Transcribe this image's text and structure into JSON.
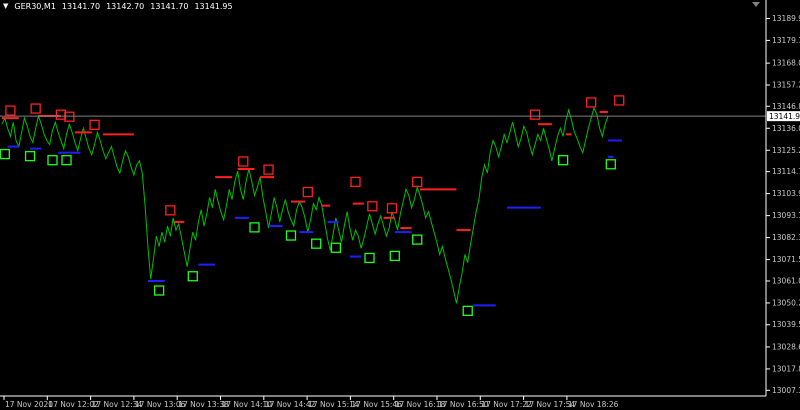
{
  "header": {
    "menu_icon": "triangle-down-icon",
    "symbol": "GER30,M1",
    "ohlc": [
      "13141.70",
      "13142.70",
      "13141.70",
      "13141.95"
    ],
    "scroll_marker_icon": "triangle-down-icon"
  },
  "chart_data": {
    "type": "line",
    "title": "GER30,M1",
    "colors": {
      "background": "#000000",
      "price_line": "#00c000",
      "axis": "#ffffff",
      "axis_text": "#c8c8c8",
      "bid_line": "#808080",
      "resistance": "#ff2020",
      "support": "#2020ff",
      "swing_high_box": "#ff2020",
      "swing_low_box": "#20ff20",
      "current_price_bg": "#ffffff",
      "current_price_text": "#000000"
    },
    "y_axis": {
      "ticks": [
        "13189.90",
        "13179.15",
        "13168.00",
        "13157.25",
        "13146.80",
        "13136.00",
        "13125.20",
        "13114.70",
        "13103.90",
        "13093.10",
        "13082.30",
        "13071.50",
        "13061.00",
        "13050.20",
        "13039.50",
        "13028.60",
        "13017.80",
        "13007.30"
      ],
      "tick_values": [
        13189.9,
        13179.15,
        13168.0,
        13157.25,
        13146.8,
        13136.0,
        13125.2,
        13114.7,
        13103.9,
        13093.1,
        13082.3,
        13071.5,
        13061.0,
        13050.2,
        13039.5,
        13028.6,
        13017.8,
        13007.3
      ],
      "current_price": "13141.95",
      "ylim": [
        13004.5,
        13199.0
      ]
    },
    "x_axis": {
      "ticks": [
        "17 Nov 2020",
        "17 Nov 12:02",
        "17 Nov 12:34",
        "17 Nov 13:06",
        "17 Nov 13:38",
        "17 Nov 14:10",
        "17 Nov 14:42",
        "17 Nov 15:14",
        "17 Nov 15:46",
        "17 Nov 16:18",
        "17 Nov 16:50",
        "17 Nov 17:22",
        "17 Nov 17:54",
        "17 Nov 18:26"
      ]
    },
    "series": [
      {
        "values": [
          13138,
          13141,
          13136,
          13132,
          13139,
          13130,
          13127,
          13134,
          13141,
          13137,
          13132,
          13129,
          13136,
          13142,
          13138,
          13133,
          13130,
          13128,
          13135,
          13139,
          13134,
          13130,
          13126,
          13133,
          13138,
          13134,
          13129,
          13125,
          13131,
          13136,
          13131,
          13126,
          13123,
          13128,
          13134,
          13130,
          13125,
          13121,
          13124,
          13127,
          13122,
          13117,
          13114,
          13120,
          13125,
          13122,
          13117,
          13113,
          13118,
          13120,
          13114,
          13098,
          13078,
          13062,
          13072,
          13083,
          13078,
          13085,
          13080,
          13088,
          13083,
          13092,
          13086,
          13089,
          13082,
          13075,
          13068,
          13077,
          13085,
          13081,
          13090,
          13096,
          13088,
          13094,
          13102,
          13097,
          13106,
          13100,
          13095,
          13091,
          13098,
          13106,
          13101,
          13110,
          13115,
          13106,
          13101,
          13110,
          13116,
          13110,
          13103,
          13107,
          13112,
          13102,
          13095,
          13087,
          13094,
          13102,
          13097,
          13090,
          13096,
          13101,
          13095,
          13091,
          13088,
          13096,
          13100,
          13097,
          13092,
          13085,
          13091,
          13099,
          13096,
          13102,
          13098,
          13090,
          13082,
          13076,
          13084,
          13092,
          13086,
          13080,
          13088,
          13095,
          13087,
          13081,
          13086,
          13083,
          13077,
          13082,
          13088,
          13094,
          13089,
          13084,
          13089,
          13093,
          13088,
          13083,
          13087,
          13095,
          13091,
          13086,
          13094,
          13100,
          13106,
          13103,
          13097,
          13101,
          13107,
          13103,
          13098,
          13092,
          13095,
          13090,
          13085,
          13080,
          13074,
          13078,
          13072,
          13067,
          13062,
          13056,
          13050,
          13058,
          13065,
          13074,
          13070,
          13079,
          13087,
          13095,
          13101,
          13112,
          13118,
          13114,
          13124,
          13130,
          13127,
          13122,
          13127,
          13133,
          13129,
          13134,
          13139,
          13133,
          13127,
          13131,
          13137,
          13134,
          13128,
          13123,
          13128,
          13133,
          13130,
          13136,
          13131,
          13126,
          13120,
          13126,
          13132,
          13136,
          13132,
          13140,
          13145,
          13140,
          13134,
          13131,
          13127,
          13124,
          13130,
          13136,
          13141,
          13146,
          13143,
          13136,
          13132,
          13138,
          13141.95
        ]
      }
    ],
    "swing_highs": [
      {
        "i": 3,
        "v": 13141
      },
      {
        "i": 12,
        "v": 13142
      },
      {
        "i": 21,
        "v": 13139
      },
      {
        "i": 24,
        "v": 13138
      },
      {
        "i": 33,
        "v": 13134
      },
      {
        "i": 60,
        "v": 13092
      },
      {
        "i": 86,
        "v": 13116
      },
      {
        "i": 95,
        "v": 13112
      },
      {
        "i": 109,
        "v": 13101
      },
      {
        "i": 126,
        "v": 13106
      },
      {
        "i": 132,
        "v": 13094
      },
      {
        "i": 139,
        "v": 13093
      },
      {
        "i": 148,
        "v": 13106
      },
      {
        "i": 190,
        "v": 13139
      },
      {
        "i": 210,
        "v": 13145
      },
      {
        "i": 220,
        "v": 13146
      }
    ],
    "swing_lows": [
      {
        "i": 1,
        "v": 13127
      },
      {
        "i": 10,
        "v": 13126
      },
      {
        "i": 18,
        "v": 13124
      },
      {
        "i": 23,
        "v": 13124
      },
      {
        "i": 56,
        "v": 13060
      },
      {
        "i": 68,
        "v": 13067
      },
      {
        "i": 90,
        "v": 13091
      },
      {
        "i": 103,
        "v": 13087
      },
      {
        "i": 112,
        "v": 13083
      },
      {
        "i": 119,
        "v": 13081
      },
      {
        "i": 131,
        "v": 13076
      },
      {
        "i": 140,
        "v": 13077
      },
      {
        "i": 148,
        "v": 13085
      },
      {
        "i": 166,
        "v": 13050
      },
      {
        "i": 200,
        "v": 13124
      },
      {
        "i": 217,
        "v": 13122
      }
    ],
    "resistance_levels": [
      {
        "i": 0,
        "v": 13141,
        "len": 6
      },
      {
        "i": 13,
        "v": 13142,
        "len": 8
      },
      {
        "i": 26,
        "v": 13134,
        "len": 6
      },
      {
        "i": 36,
        "v": 13133,
        "len": 11
      },
      {
        "i": 61,
        "v": 13090,
        "len": 4
      },
      {
        "i": 76,
        "v": 13112,
        "len": 6
      },
      {
        "i": 84,
        "v": 13116,
        "len": 6
      },
      {
        "i": 92,
        "v": 13112,
        "len": 5
      },
      {
        "i": 103,
        "v": 13100,
        "len": 5
      },
      {
        "i": 114,
        "v": 13098,
        "len": 3
      },
      {
        "i": 125,
        "v": 13099,
        "len": 4
      },
      {
        "i": 136,
        "v": 13092,
        "len": 4
      },
      {
        "i": 142,
        "v": 13087,
        "len": 4
      },
      {
        "i": 149,
        "v": 13106,
        "len": 13
      },
      {
        "i": 162,
        "v": 13086,
        "len": 5
      },
      {
        "i": 191,
        "v": 13138,
        "len": 5
      },
      {
        "i": 201,
        "v": 13133,
        "len": 2
      },
      {
        "i": 213,
        "v": 13144,
        "len": 5
      }
    ],
    "support_levels": [
      {
        "i": 2,
        "v": 13127,
        "len": 4
      },
      {
        "i": 10,
        "v": 13126,
        "len": 4
      },
      {
        "i": 20,
        "v": 13124,
        "len": 4
      },
      {
        "i": 24,
        "v": 13124,
        "len": 4
      },
      {
        "i": 52,
        "v": 13061,
        "len": 6
      },
      {
        "i": 70,
        "v": 13069,
        "len": 6
      },
      {
        "i": 83,
        "v": 13092,
        "len": 5
      },
      {
        "i": 95,
        "v": 13088,
        "len": 5
      },
      {
        "i": 106,
        "v": 13085,
        "len": 5
      },
      {
        "i": 116,
        "v": 13090,
        "len": 4
      },
      {
        "i": 124,
        "v": 13073,
        "len": 4
      },
      {
        "i": 140,
        "v": 13085,
        "len": 6
      },
      {
        "i": 168,
        "v": 13049,
        "len": 8
      },
      {
        "i": 180,
        "v": 13097,
        "len": 12
      },
      {
        "i": 218,
        "v": 13122,
        "len": 2
      },
      {
        "i": 221,
        "v": 13130,
        "len": 2
      }
    ]
  }
}
